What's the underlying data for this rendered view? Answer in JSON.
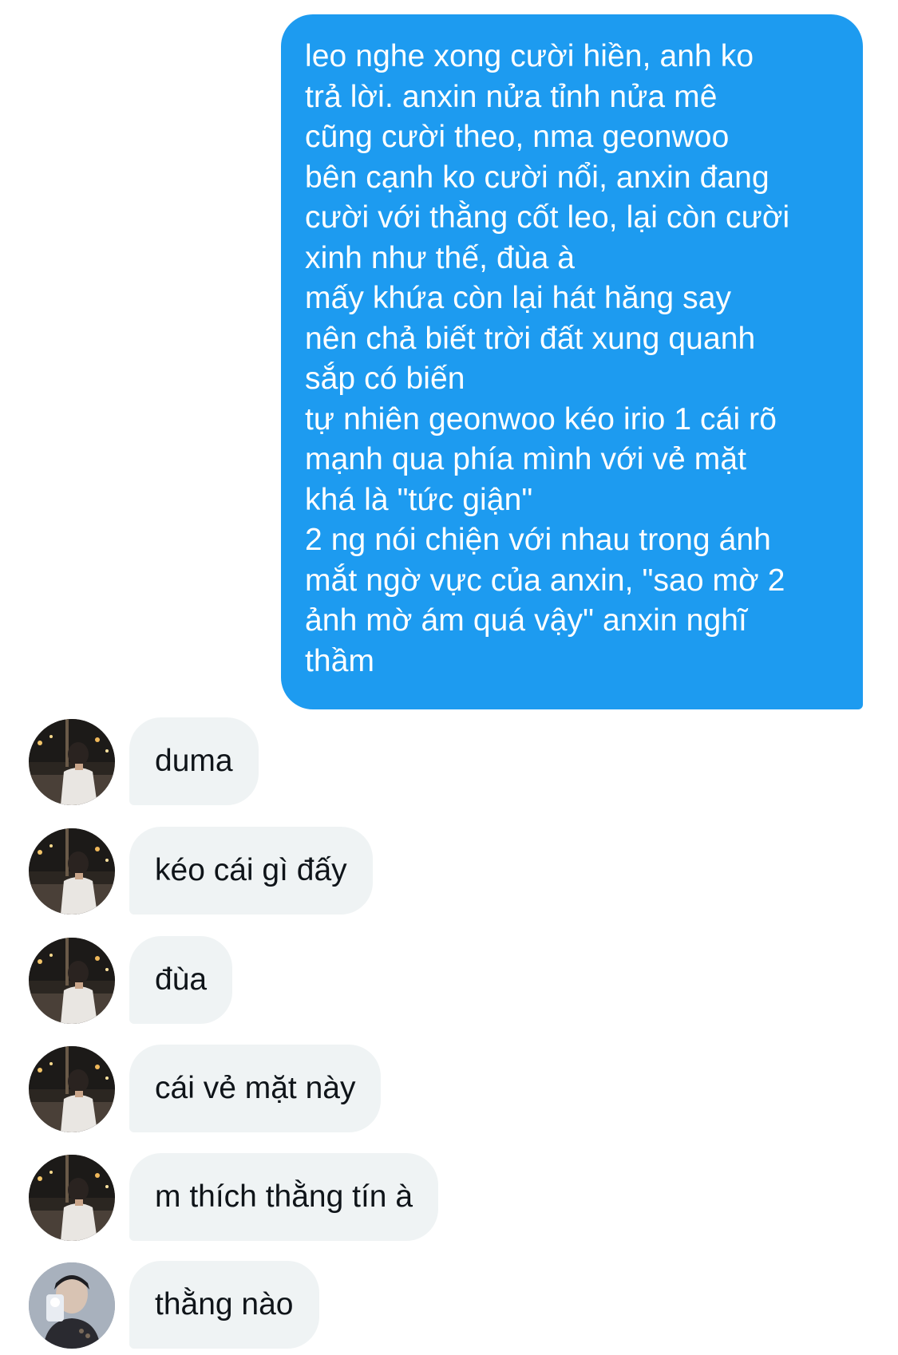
{
  "outgoing": {
    "lines": [
      "leo nghe xong cười hiền, anh ko",
      "trả lời. anxin nửa tỉnh nửa mê",
      "cũng cười theo, nma geonwoo",
      "bên cạnh ko cười nổi, anxin đang",
      "cười với thằng cốt leo, lại còn cười",
      "xinh như thế, đùa à",
      "mấy khứa còn lại hát hăng say",
      "nên chả biết trời đất xung quanh",
      "sắp có biến",
      "tự nhiên geonwoo kéo irio 1 cái rõ",
      "mạnh qua phía mình với vẻ mặt",
      "khá là \"tức giận\"",
      "2 ng nói chiện với nhau trong ánh",
      "mắt ngờ vực của anxin, \"sao mờ 2",
      "ảnh mờ ám quá vậy\" anxin nghĩ",
      "thầm"
    ],
    "color": "#1d9bf0"
  },
  "incoming": [
    {
      "text": "duma",
      "avatar": "night-street-avatar"
    },
    {
      "text": "kéo cái gì đấy",
      "avatar": "night-street-avatar"
    },
    {
      "text": "đùa",
      "avatar": "night-street-avatar"
    },
    {
      "text": "cái vẻ mặt này",
      "avatar": "night-street-avatar"
    },
    {
      "text": "m thích thằng tín à",
      "avatar": "night-street-avatar"
    },
    {
      "text": "thằng nào",
      "avatar": "mirror-selfie-avatar"
    }
  ],
  "colors": {
    "outgoing_bubble": "#1d9bf0",
    "incoming_bubble": "#eff3f4",
    "incoming_text": "#0f1419",
    "background": "#ffffff"
  }
}
